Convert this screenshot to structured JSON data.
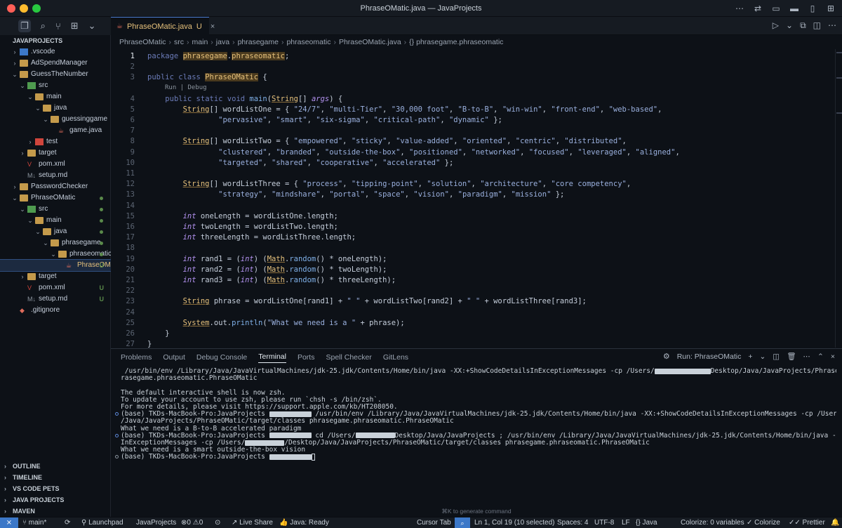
{
  "window": {
    "title": "PhraseOMatic.java — JavaProjects"
  },
  "sidebar": {
    "title": "JAVAPROJECTS",
    "tree": [
      {
        "label": ".vscode",
        "depth": 0,
        "chev": "›",
        "icon": "folder-blue",
        "status": ""
      },
      {
        "label": "AdSpendManager",
        "depth": 0,
        "chev": "›",
        "icon": "folder",
        "status": ""
      },
      {
        "label": "GuessTheNumber",
        "depth": 0,
        "chev": "⌄",
        "icon": "folder",
        "status": ""
      },
      {
        "label": "src",
        "depth": 1,
        "chev": "⌄",
        "icon": "folder-green",
        "status": ""
      },
      {
        "label": "main",
        "depth": 2,
        "chev": "⌄",
        "icon": "folder",
        "status": ""
      },
      {
        "label": "java",
        "depth": 3,
        "chev": "⌄",
        "icon": "folder",
        "status": ""
      },
      {
        "label": "guessinggame",
        "depth": 4,
        "chev": "⌄",
        "icon": "folder",
        "status": ""
      },
      {
        "label": "game.java",
        "depth": 5,
        "chev": "",
        "icon": "java-file",
        "status": ""
      },
      {
        "label": "test",
        "depth": 2,
        "chev": "›",
        "icon": "folder-red",
        "status": ""
      },
      {
        "label": "target",
        "depth": 1,
        "chev": "›",
        "icon": "folder",
        "status": ""
      },
      {
        "label": "pom.xml",
        "depth": 1,
        "chev": "",
        "icon": "maven-file",
        "status": ""
      },
      {
        "label": "setup.md",
        "depth": 1,
        "chev": "",
        "icon": "md-file",
        "status": ""
      },
      {
        "label": "PasswordChecker",
        "depth": 0,
        "chev": "›",
        "icon": "folder",
        "status": ""
      },
      {
        "label": "PhraseOMatic",
        "depth": 0,
        "chev": "⌄",
        "icon": "folder",
        "status": "dot"
      },
      {
        "label": "src",
        "depth": 1,
        "chev": "⌄",
        "icon": "folder-green",
        "status": "dot"
      },
      {
        "label": "main",
        "depth": 2,
        "chev": "⌄",
        "icon": "folder",
        "status": "dot"
      },
      {
        "label": "java",
        "depth": 3,
        "chev": "⌄",
        "icon": "folder",
        "status": "dot"
      },
      {
        "label": "phrasegame",
        "depth": 4,
        "chev": "⌄",
        "icon": "folder",
        "status": "dot"
      },
      {
        "label": "phraseomatic",
        "depth": 5,
        "chev": "⌄",
        "icon": "folder",
        "status": "dot"
      },
      {
        "label": "PhraseOM...",
        "depth": 6,
        "chev": "",
        "icon": "java-file",
        "status": "U",
        "selected": true
      },
      {
        "label": "target",
        "depth": 1,
        "chev": "›",
        "icon": "folder",
        "status": ""
      },
      {
        "label": "pom.xml",
        "depth": 1,
        "chev": "",
        "icon": "maven-file",
        "status": "U"
      },
      {
        "label": "setup.md",
        "depth": 1,
        "chev": "",
        "icon": "md-file",
        "status": "U"
      },
      {
        "label": ".gitignore",
        "depth": 0,
        "chev": "",
        "icon": "git-file",
        "status": ""
      }
    ],
    "sections": [
      "OUTLINE",
      "TIMELINE",
      "VS CODE PETS",
      "JAVA PROJECTS",
      "MAVEN"
    ]
  },
  "editor": {
    "tab": {
      "name": "PhraseOMatic.java",
      "status": "U"
    },
    "breadcrumb": [
      "PhraseOMatic",
      "src",
      "main",
      "java",
      "phrasegame",
      "phraseomatic",
      "PhraseOMatic.java",
      "{} phrasegame.phraseomatic"
    ],
    "codelens": "Run | Debug",
    "lines": [
      {
        "n": "1",
        "tokens": [
          [
            "kw",
            "package "
          ],
          [
            "hl",
            "phrasegame"
          ],
          [
            "pm",
            "."
          ],
          [
            "hl",
            "phraseomatic"
          ],
          [
            "pm",
            ";"
          ]
        ]
      },
      {
        "n": "2",
        "tokens": []
      },
      {
        "n": "3",
        "tokens": [
          [
            "kw",
            "public class "
          ],
          [
            "hl",
            "PhraseOMatic"
          ],
          [
            "pm",
            " {"
          ]
        ]
      },
      {
        "n": "4",
        "tokens": [
          [
            "pm",
            "    "
          ],
          [
            "kw",
            "public static void "
          ],
          [
            "fn",
            "main"
          ],
          [
            "pm",
            "("
          ],
          [
            "ty",
            "String"
          ],
          [
            "pm",
            "[] "
          ],
          [
            "it",
            "args"
          ],
          [
            "pm",
            ") {"
          ]
        ]
      },
      {
        "n": "5",
        "tokens": [
          [
            "pm",
            "        "
          ],
          [
            "ty",
            "String"
          ],
          [
            "pm",
            "[] wordListOne = { "
          ],
          [
            "str",
            "\"24/7\""
          ],
          [
            "pm",
            ", "
          ],
          [
            "str",
            "\"multi-Tier\""
          ],
          [
            "pm",
            ", "
          ],
          [
            "str",
            "\"30,000 foot\""
          ],
          [
            "pm",
            ", "
          ],
          [
            "str",
            "\"B-to-B\""
          ],
          [
            "pm",
            ", "
          ],
          [
            "str",
            "\"win-win\""
          ],
          [
            "pm",
            ", "
          ],
          [
            "str",
            "\"front-end\""
          ],
          [
            "pm",
            ", "
          ],
          [
            "str",
            "\"web-based\""
          ],
          [
            "pm",
            ","
          ]
        ]
      },
      {
        "n": "6",
        "tokens": [
          [
            "pm",
            "                "
          ],
          [
            "str",
            "\"pervasive\""
          ],
          [
            "pm",
            ", "
          ],
          [
            "str",
            "\"smart\""
          ],
          [
            "pm",
            ", "
          ],
          [
            "str",
            "\"six-sigma\""
          ],
          [
            "pm",
            ", "
          ],
          [
            "str",
            "\"critical-path\""
          ],
          [
            "pm",
            ", "
          ],
          [
            "str",
            "\"dynamic\""
          ],
          [
            "pm",
            " };"
          ]
        ]
      },
      {
        "n": "7",
        "tokens": []
      },
      {
        "n": "8",
        "tokens": [
          [
            "pm",
            "        "
          ],
          [
            "ty",
            "String"
          ],
          [
            "pm",
            "[] wordListTwo = { "
          ],
          [
            "str",
            "\"empowered\""
          ],
          [
            "pm",
            ", "
          ],
          [
            "str",
            "\"sticky\""
          ],
          [
            "pm",
            ", "
          ],
          [
            "str",
            "\"value-added\""
          ],
          [
            "pm",
            ", "
          ],
          [
            "str",
            "\"oriented\""
          ],
          [
            "pm",
            ", "
          ],
          [
            "str",
            "\"centric\""
          ],
          [
            "pm",
            ", "
          ],
          [
            "str",
            "\"distributed\""
          ],
          [
            "pm",
            ","
          ]
        ]
      },
      {
        "n": "9",
        "tokens": [
          [
            "pm",
            "                "
          ],
          [
            "str",
            "\"clustered\""
          ],
          [
            "pm",
            ", "
          ],
          [
            "str",
            "\"branded\""
          ],
          [
            "pm",
            ", "
          ],
          [
            "str",
            "\"outside-the-box\""
          ],
          [
            "pm",
            ", "
          ],
          [
            "str",
            "\"positioned\""
          ],
          [
            "pm",
            ", "
          ],
          [
            "str",
            "\"networked\""
          ],
          [
            "pm",
            ", "
          ],
          [
            "str",
            "\"focused\""
          ],
          [
            "pm",
            ", "
          ],
          [
            "str",
            "\"leveraged\""
          ],
          [
            "pm",
            ", "
          ],
          [
            "str",
            "\"aligned\""
          ],
          [
            "pm",
            ","
          ]
        ]
      },
      {
        "n": "10",
        "tokens": [
          [
            "pm",
            "                "
          ],
          [
            "str",
            "\"targeted\""
          ],
          [
            "pm",
            ", "
          ],
          [
            "str",
            "\"shared\""
          ],
          [
            "pm",
            ", "
          ],
          [
            "str",
            "\"cooperative\""
          ],
          [
            "pm",
            ", "
          ],
          [
            "str",
            "\"accelerated\""
          ],
          [
            "pm",
            " };"
          ]
        ]
      },
      {
        "n": "11",
        "tokens": []
      },
      {
        "n": "12",
        "tokens": [
          [
            "pm",
            "        "
          ],
          [
            "ty",
            "String"
          ],
          [
            "pm",
            "[] wordListThree = { "
          ],
          [
            "str",
            "\"process\""
          ],
          [
            "pm",
            ", "
          ],
          [
            "str",
            "\"tipping-point\""
          ],
          [
            "pm",
            ", "
          ],
          [
            "str",
            "\"solution\""
          ],
          [
            "pm",
            ", "
          ],
          [
            "str",
            "\"architecture\""
          ],
          [
            "pm",
            ", "
          ],
          [
            "str",
            "\"core competency\""
          ],
          [
            "pm",
            ","
          ]
        ]
      },
      {
        "n": "13",
        "tokens": [
          [
            "pm",
            "                "
          ],
          [
            "str",
            "\"strategy\""
          ],
          [
            "pm",
            ", "
          ],
          [
            "str",
            "\"mindshare\""
          ],
          [
            "pm",
            ", "
          ],
          [
            "str",
            "\"portal\""
          ],
          [
            "pm",
            ", "
          ],
          [
            "str",
            "\"space\""
          ],
          [
            "pm",
            ", "
          ],
          [
            "str",
            "\"vision\""
          ],
          [
            "pm",
            ", "
          ],
          [
            "str",
            "\"paradigm\""
          ],
          [
            "pm",
            ", "
          ],
          [
            "str",
            "\"mission\""
          ],
          [
            "pm",
            " };"
          ]
        ]
      },
      {
        "n": "14",
        "tokens": []
      },
      {
        "n": "15",
        "tokens": [
          [
            "pm",
            "        "
          ],
          [
            "it",
            "int"
          ],
          [
            "pm",
            " oneLength = wordListOne.length;"
          ]
        ]
      },
      {
        "n": "16",
        "tokens": [
          [
            "pm",
            "        "
          ],
          [
            "it",
            "int"
          ],
          [
            "pm",
            " twoLength = wordListTwo.length;"
          ]
        ]
      },
      {
        "n": "17",
        "tokens": [
          [
            "pm",
            "        "
          ],
          [
            "it",
            "int"
          ],
          [
            "pm",
            " threeLength = wordListThree.length;"
          ]
        ]
      },
      {
        "n": "18",
        "tokens": []
      },
      {
        "n": "19",
        "tokens": [
          [
            "pm",
            "        "
          ],
          [
            "it",
            "int"
          ],
          [
            "pm",
            " rand1 = ("
          ],
          [
            "it",
            "int"
          ],
          [
            "pm",
            ") ("
          ],
          [
            "ty",
            "Math"
          ],
          [
            "pm",
            "."
          ],
          [
            "fn",
            "random"
          ],
          [
            "pm",
            "() * oneLength);"
          ]
        ]
      },
      {
        "n": "20",
        "tokens": [
          [
            "pm",
            "        "
          ],
          [
            "it",
            "int"
          ],
          [
            "pm",
            " rand2 = ("
          ],
          [
            "it",
            "int"
          ],
          [
            "pm",
            ") ("
          ],
          [
            "ty",
            "Math"
          ],
          [
            "pm",
            "."
          ],
          [
            "fn",
            "random"
          ],
          [
            "pm",
            "() * twoLength);"
          ]
        ]
      },
      {
        "n": "21",
        "tokens": [
          [
            "pm",
            "        "
          ],
          [
            "it",
            "int"
          ],
          [
            "pm",
            " rand3 = ("
          ],
          [
            "it",
            "int"
          ],
          [
            "pm",
            ") ("
          ],
          [
            "ty",
            "Math"
          ],
          [
            "pm",
            "."
          ],
          [
            "fn",
            "random"
          ],
          [
            "pm",
            "() * threeLength);"
          ]
        ]
      },
      {
        "n": "22",
        "tokens": []
      },
      {
        "n": "23",
        "tokens": [
          [
            "pm",
            "        "
          ],
          [
            "ty",
            "String"
          ],
          [
            "pm",
            " phrase = wordListOne[rand1] + "
          ],
          [
            "str",
            "\" \""
          ],
          [
            "pm",
            " + wordListTwo[rand2] + "
          ],
          [
            "str",
            "\" \""
          ],
          [
            "pm",
            " + wordListThree[rand3];"
          ]
        ]
      },
      {
        "n": "24",
        "tokens": []
      },
      {
        "n": "25",
        "tokens": [
          [
            "pm",
            "        "
          ],
          [
            "ty",
            "System"
          ],
          [
            "pm",
            ".out."
          ],
          [
            "fn",
            "println"
          ],
          [
            "pm",
            "("
          ],
          [
            "str",
            "\"What we need is a \""
          ],
          [
            "pm",
            " + phrase);"
          ]
        ]
      },
      {
        "n": "26",
        "tokens": [
          [
            "pm",
            "    }"
          ]
        ]
      },
      {
        "n": "27",
        "tokens": [
          [
            "pm",
            "}"
          ]
        ]
      }
    ]
  },
  "panel": {
    "tabs": [
      "Problems",
      "Output",
      "Debug Console",
      "Terminal",
      "Ports",
      "Spell Checker",
      "GitLens"
    ],
    "active_tab": "Terminal",
    "run_label": "Run: PhraseOMatic",
    "terminal": [
      {
        "dot": "",
        "text": " /usr/bin/env /Library/Java/JavaVirtualMachines/jdk-25.jdk/Contents/Home/bin/java -XX:+ShowCodeDetailsInExceptionMessages -cp /Users/",
        "redact": 80,
        "tail": "Desktop/Java/JavaProjects/PhraseOMatic/target/classes ph"
      },
      {
        "dot": "",
        "text": "rasegame.phraseomatic.PhraseOMatic"
      },
      {
        "dot": "",
        "text": ""
      },
      {
        "dot": "",
        "text": "The default interactive shell is now zsh."
      },
      {
        "dot": "",
        "text": "To update your account to use zsh, please run `chsh -s /bin/zsh`."
      },
      {
        "dot": "",
        "text": "For more details, please visit https://support.apple.com/kb/HT208050."
      },
      {
        "dot": "done",
        "text": "(base) TKDs-MacBook-Pro:JavaProjects ",
        "redact": 60,
        "tail": " /usr/bin/env /Library/Java/JavaVirtualMachines/jdk-25.jdk/Contents/Home/bin/java -XX:+ShowCodeDetailsInExceptionMessages -cp /Users/",
        "redact2": 60,
        "tail2": "Desktop"
      },
      {
        "dot": "",
        "text": "/Java/JavaProjects/PhraseOMatic/target/classes phrasegame.phraseomatic.PhraseOMatic"
      },
      {
        "dot": "",
        "text": "What we need is a B-to-B accelerated paradigm"
      },
      {
        "dot": "done",
        "text": "(base) TKDs-MacBook-Pro:JavaProjects ",
        "redact": 60,
        "tail": " cd /Users/",
        "redact2": 56,
        "tail2": "Desktop/Java/JavaProjects ; /usr/bin/env /Library/Java/JavaVirtualMachines/jdk-25.jdk/Contents/Home/bin/java -XX:+ShowCodeDetails"
      },
      {
        "dot": "",
        "text": "InExceptionMessages -cp /Users/",
        "redact": 56,
        "tail": "/Desktop/Java/JavaProjects/PhraseOMatic/target/classes phrasegame.phraseomatic.PhraseOMatic"
      },
      {
        "dot": "",
        "text": "What we need is a smart outside-the-box vision"
      },
      {
        "dot": "open",
        "text": "(base) TKDs-MacBook-Pro:JavaProjects ",
        "redact": 60,
        "tail": "",
        "cursor": true
      }
    ],
    "hint": "⌘K to generate command"
  },
  "statusbar": {
    "branch": "main*",
    "launchpad": "Launchpad",
    "project": "JavaProjects",
    "errors": "0",
    "warnings": "0",
    "liveshare": "Live Share",
    "java": "Java: Ready",
    "cursor_tab": "Cursor Tab",
    "position": "Ln 1, Col 19 (10 selected)",
    "spaces": "Spaces: 4",
    "encoding": "UTF-8",
    "eol": "LF",
    "language": "Java",
    "colorize_vars": "Colorize: 0 variables",
    "colorize": "Colorize",
    "prettier": "Prettier"
  },
  "colors": {
    "accent": "#3c78c8",
    "modified": "#e5c07b",
    "added": "#5a8a4a"
  }
}
